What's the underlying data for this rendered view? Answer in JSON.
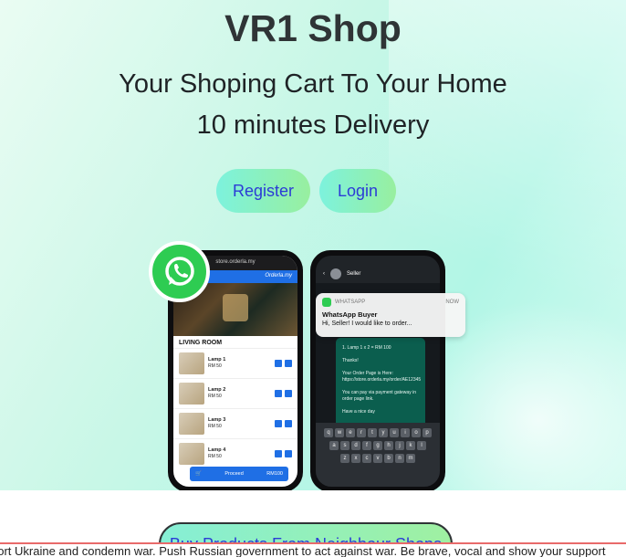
{
  "site": {
    "title": "VR1 Shop",
    "tagline": "Your Shoping Cart To Your Home",
    "delivery": "10 minutes Delivery"
  },
  "buttons": {
    "register": "Register",
    "login": "Login",
    "products": "Buy Products From Neighbour Shops"
  },
  "illustration": {
    "store_url": "store.orderla.my",
    "brand": "Orderla.my",
    "room_label": "LIVING ROOM",
    "products": [
      {
        "name": "Lamp 1",
        "price": "RM 50"
      },
      {
        "name": "Lamp 2",
        "price": "RM 50"
      },
      {
        "name": "Lamp 3",
        "price": "RM 50"
      },
      {
        "name": "Lamp 4",
        "price": "RM 50"
      }
    ],
    "proceed": "Proceed",
    "total": "RM100",
    "chat_contact": "Seller",
    "chat_lines": [
      "1. Lamp 1 x 2 = RM 100",
      "Thanks!",
      "Your Order Page is Here: https://store.orderla.my/order/AE12345",
      "You can pay via payment gateway in order page link.",
      "Have a nice day"
    ],
    "notification": {
      "app": "WHATSAPP",
      "time": "NOW",
      "title": "WhatsApp Buyer",
      "message": "Hi, Seller!  I would like to order..."
    },
    "keyboard_rows": [
      [
        "q",
        "w",
        "e",
        "r",
        "t",
        "y",
        "u",
        "i",
        "o",
        "p"
      ],
      [
        "a",
        "s",
        "d",
        "f",
        "g",
        "h",
        "j",
        "k",
        "l"
      ],
      [
        "z",
        "x",
        "c",
        "v",
        "b",
        "n",
        "m"
      ]
    ]
  },
  "banner": {
    "text": "port Ukraine and condemn war. Push Russian government to act against war. Be brave, vocal and show your support"
  },
  "colors": {
    "accent_text": "#2b3bd6",
    "button_gradient_start": "#7df2dd",
    "button_gradient_end": "#98ef9f",
    "whatsapp_green": "#2ecc52",
    "banner_border": "#e86a6a"
  }
}
